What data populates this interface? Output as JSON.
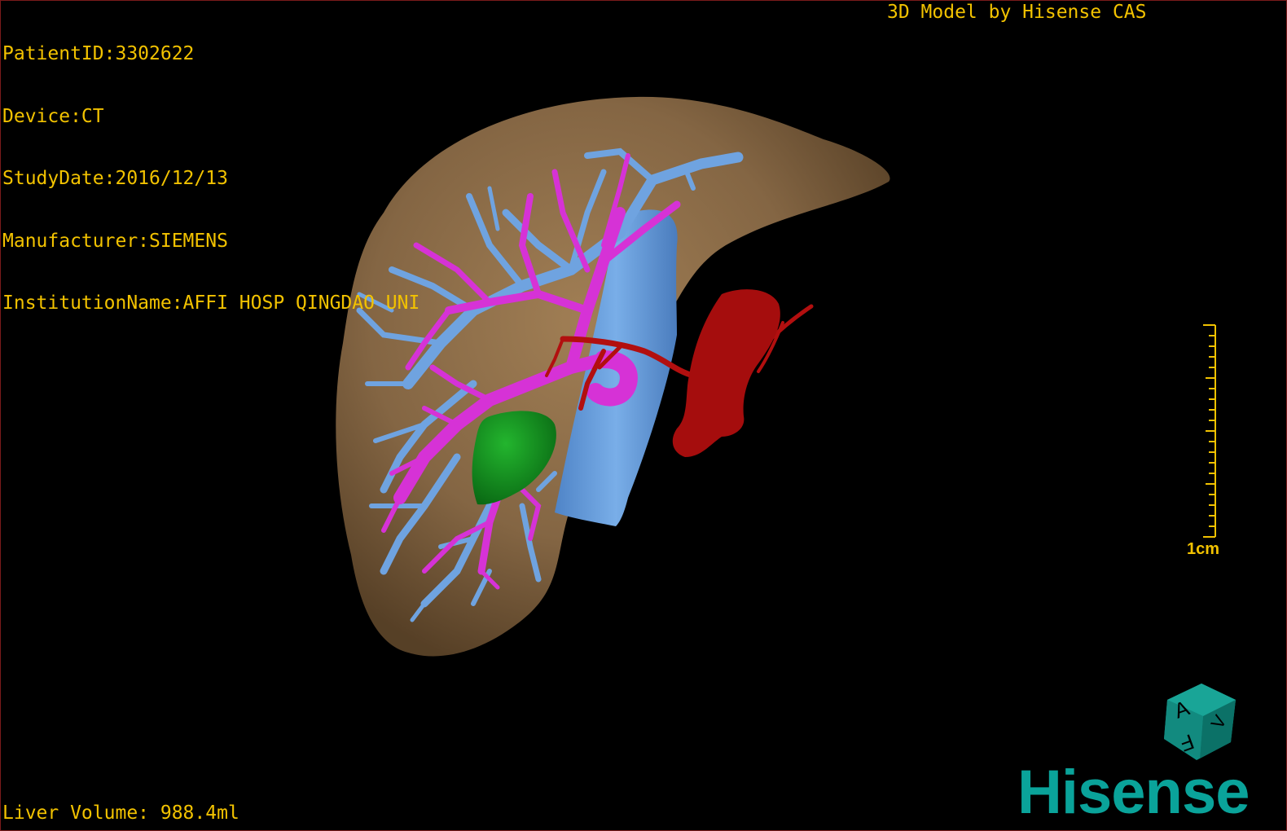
{
  "header": {
    "lines": [
      "PatientID:3302622",
      "Device:CT",
      "StudyDate:2016/12/13",
      "Manufacturer:SIEMENS",
      "InstitutionName:AFFI HOSP QINGDAO UNI"
    ],
    "title": "3D Model by Hisense CAS"
  },
  "footer": {
    "volume": "Liver Volume: 988.4ml"
  },
  "scale_bar": {
    "label": "1cm"
  },
  "orientation_cube": {
    "face_labels": [
      "A",
      "F",
      "V"
    ]
  },
  "brand": {
    "name": "Hisense"
  },
  "colors": {
    "text": "#f2c200",
    "liver": "#8b6b47",
    "hepatic_veins": "#6fa3e0",
    "portal_vein": "#d632d6",
    "artery": "#b20f0f",
    "lesion": "#0f8a1a",
    "brand": "#0aa39a"
  }
}
